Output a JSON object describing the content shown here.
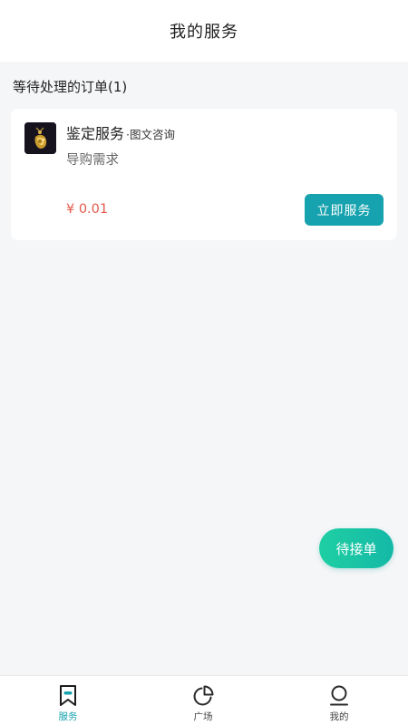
{
  "header": {
    "title": "我的服务"
  },
  "pending": {
    "section_title": "等待处理的订单(1)"
  },
  "order": {
    "service_name": "鉴定服务",
    "service_type": "·图文咨询",
    "description": "导购需求",
    "price": "¥ 0.01",
    "action_label": "立即服务"
  },
  "fab": {
    "label": "待接单"
  },
  "tabbar": {
    "items": [
      {
        "label": "服务",
        "icon": "bookmark-icon",
        "active": true
      },
      {
        "label": "广场",
        "icon": "pie-chart-icon",
        "active": false
      },
      {
        "label": "我的",
        "icon": "user-icon",
        "active": false
      }
    ]
  },
  "colors": {
    "accent": "#16a2ae",
    "price": "#e45a4c",
    "fab_gradient_start": "#1fcfa3",
    "fab_gradient_end": "#14b9a6"
  }
}
